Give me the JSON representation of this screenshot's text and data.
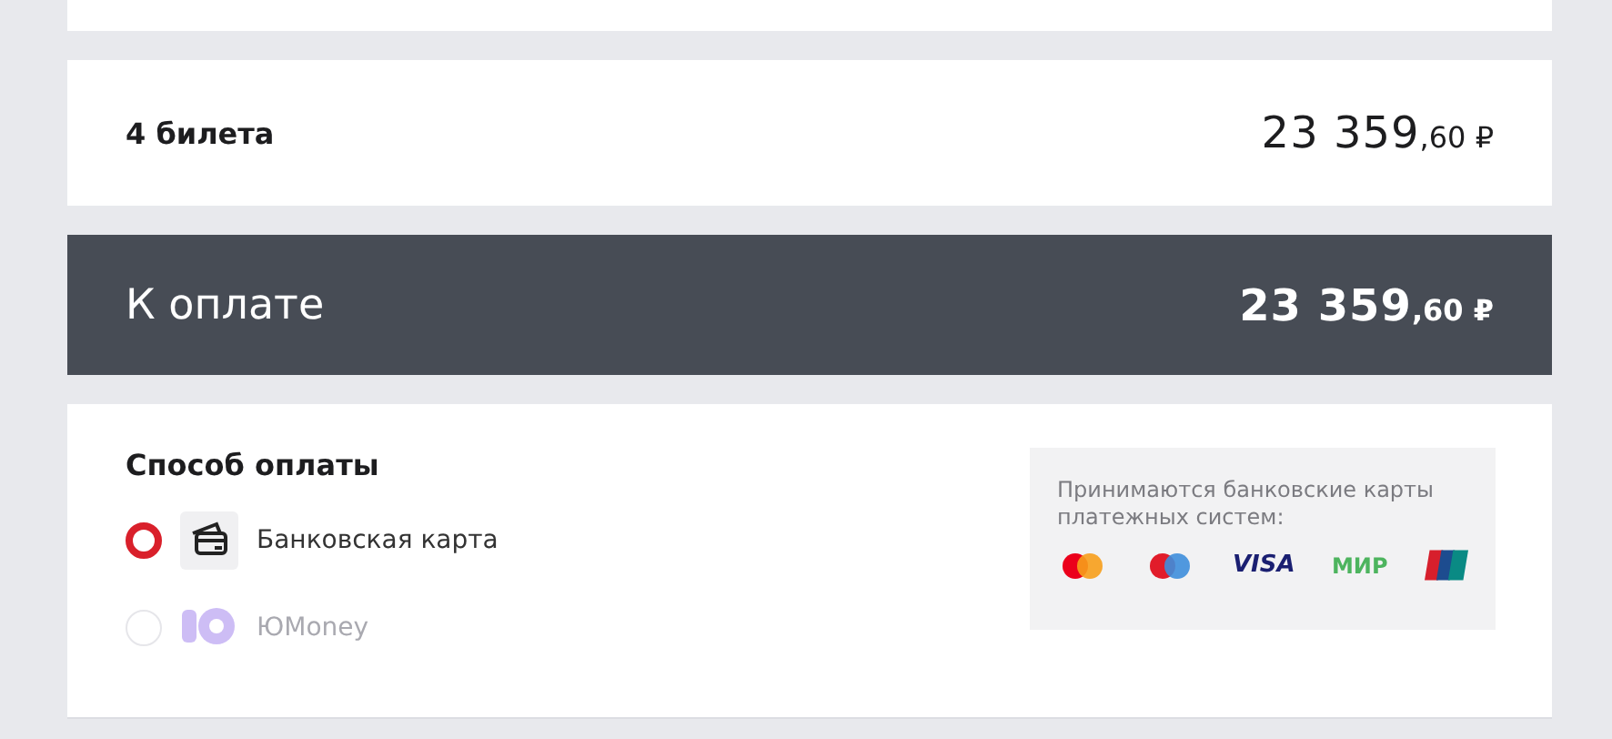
{
  "summary": {
    "label": "4 билета",
    "amount": "23 359",
    "fraction": ",60",
    "currency": "₽"
  },
  "total": {
    "label": "К оплате",
    "amount": "23 359",
    "fraction": ",60",
    "currency": "₽"
  },
  "payment": {
    "title": "Способ оплаты",
    "methods": [
      {
        "kind": "card",
        "label": "Банковская карта",
        "selected": true,
        "disabled": false
      },
      {
        "kind": "yoomoney",
        "label": "ЮMoney",
        "selected": false,
        "disabled": true
      }
    ],
    "accepted_note": "Принимаются банковские карты платежных систем:",
    "systems": [
      {
        "kind": "mastercard"
      },
      {
        "kind": "maestro"
      },
      {
        "kind": "visa",
        "label": "VISA"
      },
      {
        "kind": "mir",
        "label": "МИР"
      },
      {
        "kind": "unionpay"
      }
    ]
  }
}
